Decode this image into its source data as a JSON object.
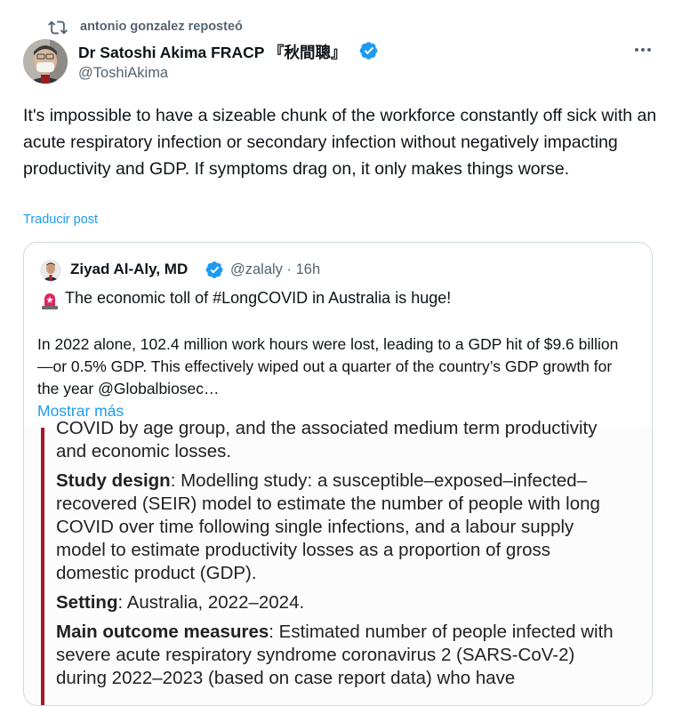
{
  "repost": {
    "text": "antonio gonzalez reposteó",
    "icon": "repost-icon"
  },
  "author": {
    "name": "Dr Satoshi Akima FRACP 『秋間聰』",
    "handle": "@ToshiAkima",
    "verified_icon": "verified-badge-icon",
    "badge_color": "#1d9bf0"
  },
  "post": {
    "text": "It's impossible to have a sizeable chunk of the workforce constantly off sick with an acute respiratory infection or secondary infection without negatively impacting productivity and GDP. If symptoms drag on, it only makes things worse.",
    "translate_label": "Traducir post"
  },
  "quote": {
    "name": "Ziyad Al-Aly, MD",
    "handle": "@zalaly",
    "separator": "·",
    "time": "16h",
    "line1": "The economic toll of #LongCOVID in Australia is huge!",
    "paragraph": "In 2022 alone, 102.4 million work hours were lost, leading to a GDP hit of $9.6 billion—or 0.5% GDP. This effectively wiped out a quarter of the country’s GDP growth for the year @Globalbiosec…",
    "show_more": "Mostrar más"
  },
  "article": {
    "cut_line": "COVID by age group, and the associated medium term productivity",
    "line_economic": "and economic losses.",
    "study_design_head": "Study design",
    "study_design_text": ": Modelling study: a susceptible–exposed–infected–recovered (SEIR) model to estimate the number of people with long COVID over time following single infections, and a labour supply model to estimate productivity losses as a proportion of gross domestic product (GDP).",
    "setting_head": "Setting",
    "setting_text": ": Australia, 2022–2024.",
    "outcome_head": "Main outcome measures",
    "outcome_text": ": Estimated number of people infected with severe acute respiratory syndrome coronavirus 2 (SARS-CoV-2) during 2022–2023 (based on case report data) who have",
    "accent_color": "#a6192e"
  }
}
